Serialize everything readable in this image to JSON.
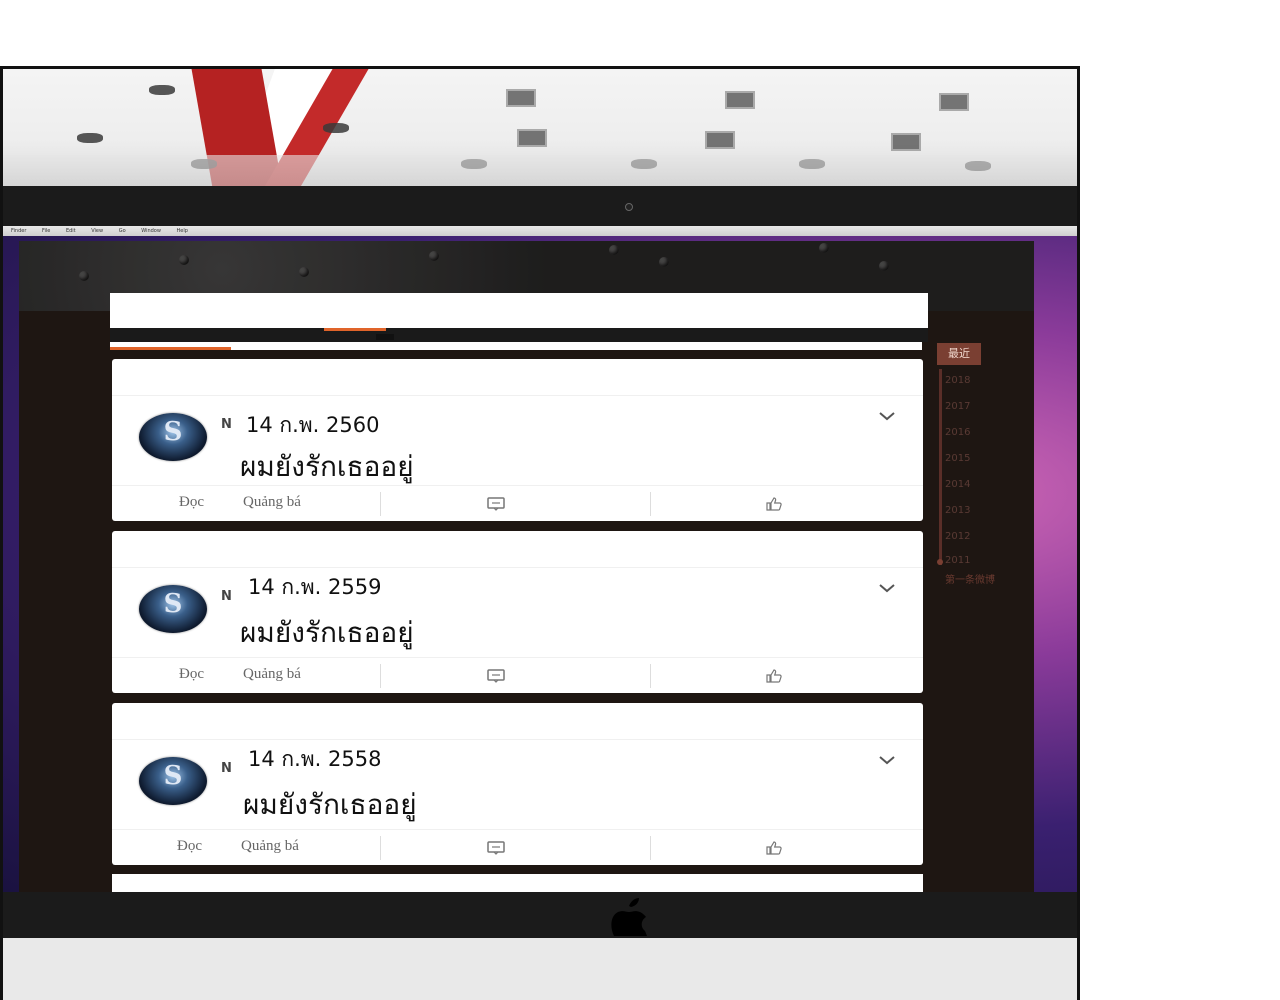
{
  "screen": {
    "menubar_items": [
      "Finder",
      "File",
      "Edit",
      "View",
      "Go",
      "Window",
      "Help"
    ]
  },
  "timeline": {
    "current_label": "最近",
    "years": [
      "2018",
      "2017",
      "2016",
      "2015",
      "2014",
      "2013",
      "2012",
      "2011"
    ],
    "first_post_label": "第一条微博"
  },
  "posts": [
    {
      "initial": "N",
      "date": "14 ก.พ. 2560",
      "message": "ผมยังรักเธออยู่",
      "read_label": "Đọc",
      "promote_label": "Quảng bá"
    },
    {
      "initial": "N",
      "date": "14 ก.พ. 2559",
      "message": "ผมยังรักเธออยู่",
      "read_label": "Đọc",
      "promote_label": "Quảng bá"
    },
    {
      "initial": "N",
      "date": "14 ก.พ. 2558",
      "message": "ผมยังรักเธออยู่",
      "read_label": "Đọc",
      "promote_label": "Quảng bá"
    }
  ],
  "icons": {
    "expand": "chevron-down-icon",
    "comment": "comment-icon",
    "like": "thumbs-up-icon",
    "avatar_glyph": "S"
  },
  "colors": {
    "accent": "#e0642a",
    "timeline_active": "#7a3f32",
    "browser_bg": "#1e1612"
  }
}
